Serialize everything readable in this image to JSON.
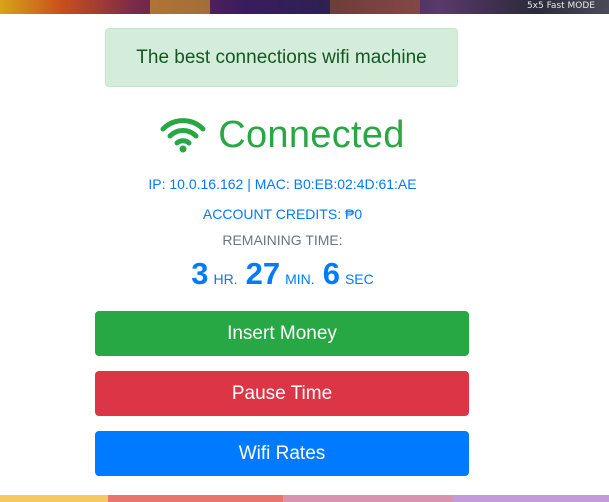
{
  "banner": {
    "caption": "5x5 Fast MODE"
  },
  "notice": {
    "text": "The best connections wifi machine"
  },
  "status": {
    "label": "Connected",
    "icon": "wifi-icon",
    "color": "#28a745"
  },
  "network": {
    "ip_line": "IP: 10.0.16.162 | MAC: B0:EB:02:4D:61:AE"
  },
  "account": {
    "credits_line": "ACCOUNT CREDITS: ₱0"
  },
  "remaining": {
    "label": "REMAINING TIME:",
    "hours": "3",
    "hours_unit": "HR.",
    "minutes": "27",
    "minutes_unit": "MIN.",
    "seconds": "6",
    "seconds_unit": "SEC"
  },
  "buttons": {
    "insert_money": "Insert Money",
    "pause_time": "Pause Time",
    "wifi_rates": "Wifi Rates"
  },
  "colors": {
    "success": "#28a745",
    "danger": "#dc3545",
    "primary": "#007bff",
    "muted": "#6c757d",
    "footer": [
      "#f6c85f",
      "#e8766e",
      "#d993b0",
      "#c39bd9"
    ]
  }
}
